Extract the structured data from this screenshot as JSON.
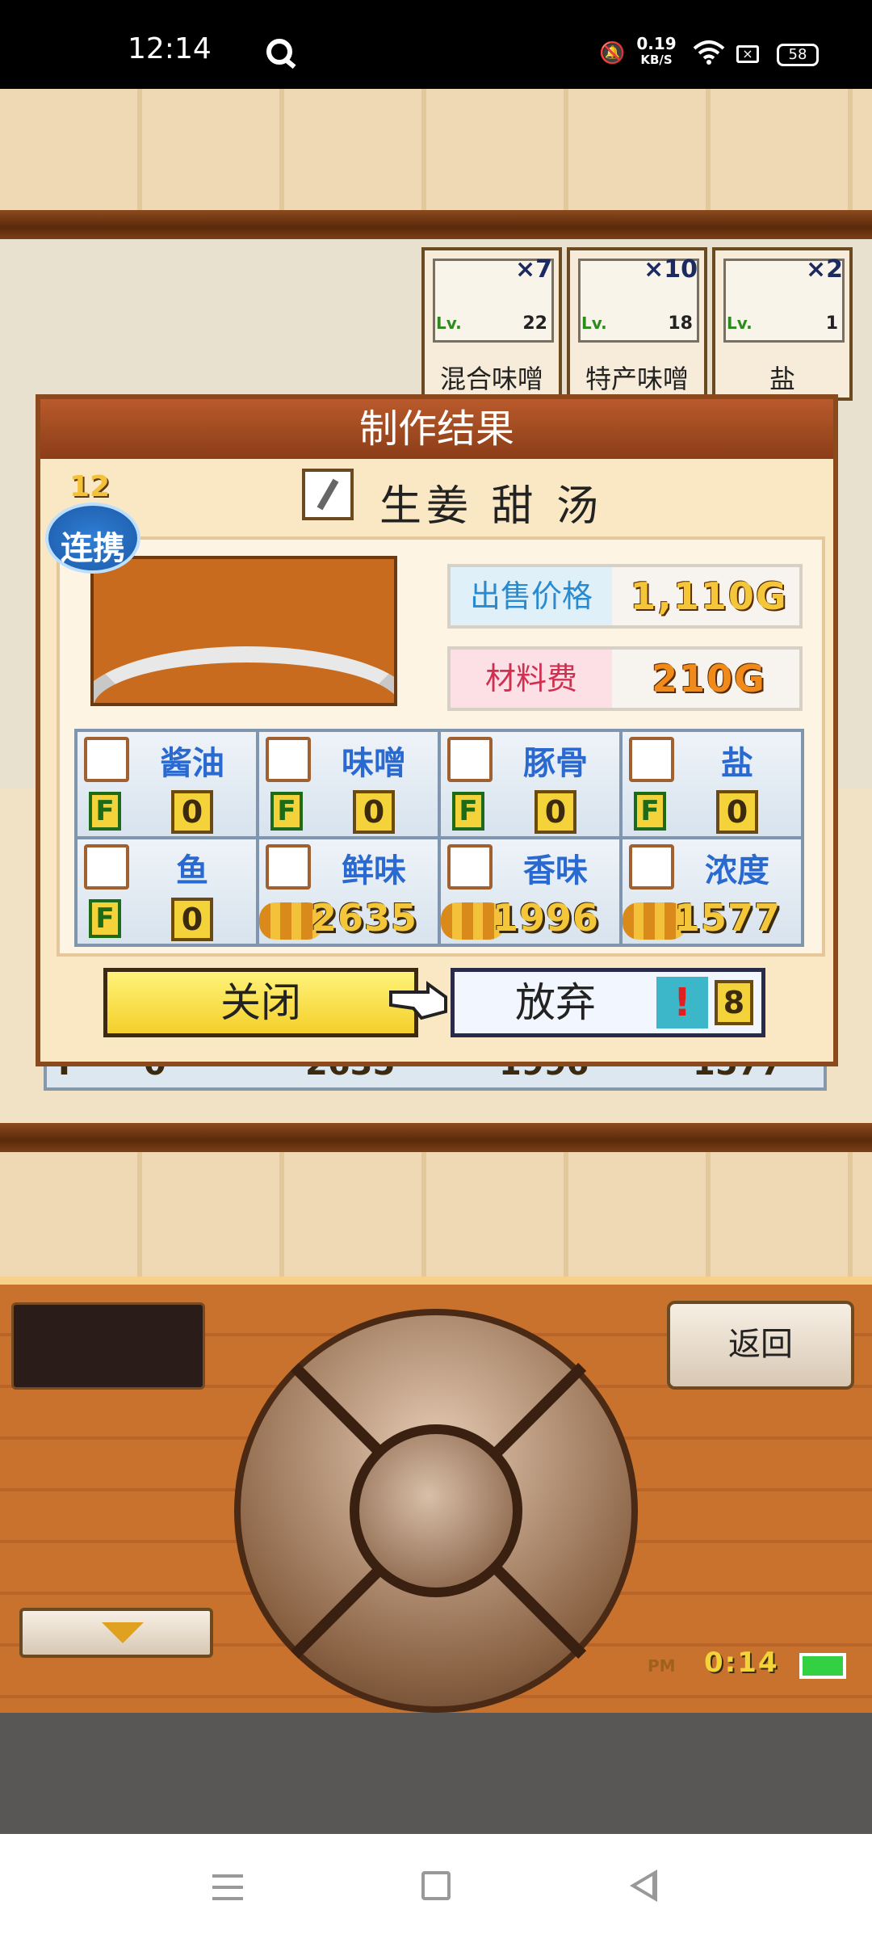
{
  "status_bar": {
    "time": "12:14",
    "net_speed": "0.19",
    "net_unit": "KB/S",
    "battery": "58"
  },
  "shelf": {
    "items": [
      {
        "name": "混合味噌",
        "count": "7",
        "level": "22"
      },
      {
        "name": "特产味噌",
        "count": "10",
        "level": "18"
      },
      {
        "name": "盐",
        "count": "2",
        "level": "1"
      }
    ]
  },
  "dialog": {
    "title": "制作结果",
    "dish_name": "生姜 甜 汤",
    "combo_level": "12",
    "combo_label": "连携",
    "sale_price_label": "出售价格",
    "sale_price_value": "1,110G",
    "material_cost_label": "材料费",
    "material_cost_value": "210G",
    "stats": [
      {
        "name": "酱油",
        "rank": "F",
        "value": "0",
        "icon": "soy-sauce-icon"
      },
      {
        "name": "味噌",
        "rank": "F",
        "value": "0",
        "icon": "miso-icon"
      },
      {
        "name": "豚骨",
        "rank": "F",
        "value": "0",
        "icon": "pork-bone-icon"
      },
      {
        "name": "盐",
        "rank": "F",
        "value": "0",
        "icon": "salt-icon"
      },
      {
        "name": "鱼",
        "rank": "F",
        "value": "0",
        "icon": "fish-icon"
      },
      {
        "name": "鲜味",
        "value": "2635",
        "icon": "umami-icon"
      },
      {
        "name": "香味",
        "value": "1996",
        "icon": "aroma-icon"
      },
      {
        "name": "浓度",
        "value": "1577",
        "icon": "density-icon"
      }
    ],
    "close_label": "关闭",
    "giveup_label": "放弃",
    "giveup_count": "8"
  },
  "background_row": {
    "rank": "F",
    "value0": "0",
    "value1": "2635",
    "value2": "1996",
    "value3": "1577"
  },
  "controller": {
    "back_label": "返回",
    "clock": "0:14",
    "pm": "PM"
  },
  "colors": {
    "accent_yellow": "#f4d23a",
    "frame_brown": "#8b4a1e",
    "stat_blue": "#2a6ad0"
  }
}
